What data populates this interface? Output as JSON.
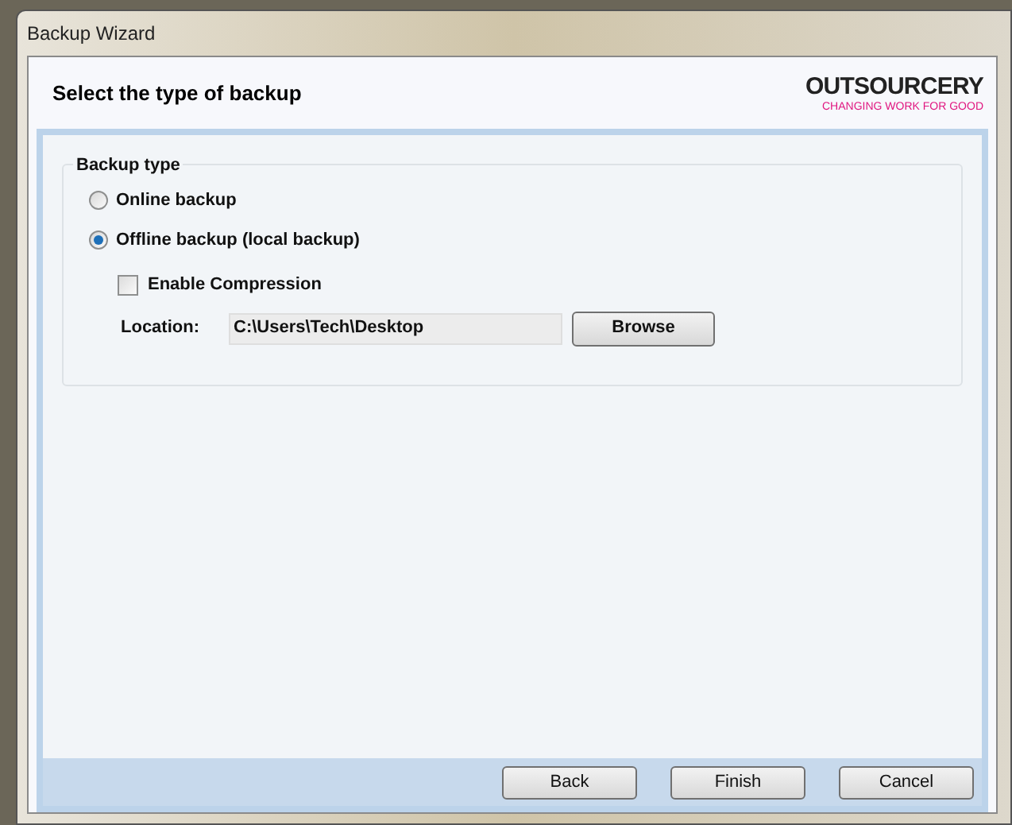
{
  "window": {
    "title": "Backup Wizard"
  },
  "header": {
    "title": "Select the type of backup",
    "logo": {
      "name": "OUTSOURCERY",
      "tagline": "CHANGING WORK FOR GOOD"
    }
  },
  "group": {
    "title": "Backup type",
    "options": [
      {
        "label": "Online backup",
        "selected": false
      },
      {
        "label": "Offline backup (local backup)",
        "selected": true
      }
    ],
    "compression": {
      "label": "Enable Compression",
      "checked": false
    },
    "location": {
      "label": "Location:",
      "value": "C:\\Users\\Tech\\Desktop",
      "button": "Browse"
    }
  },
  "buttons": [
    "Back",
    "Finish",
    "Cancel"
  ]
}
